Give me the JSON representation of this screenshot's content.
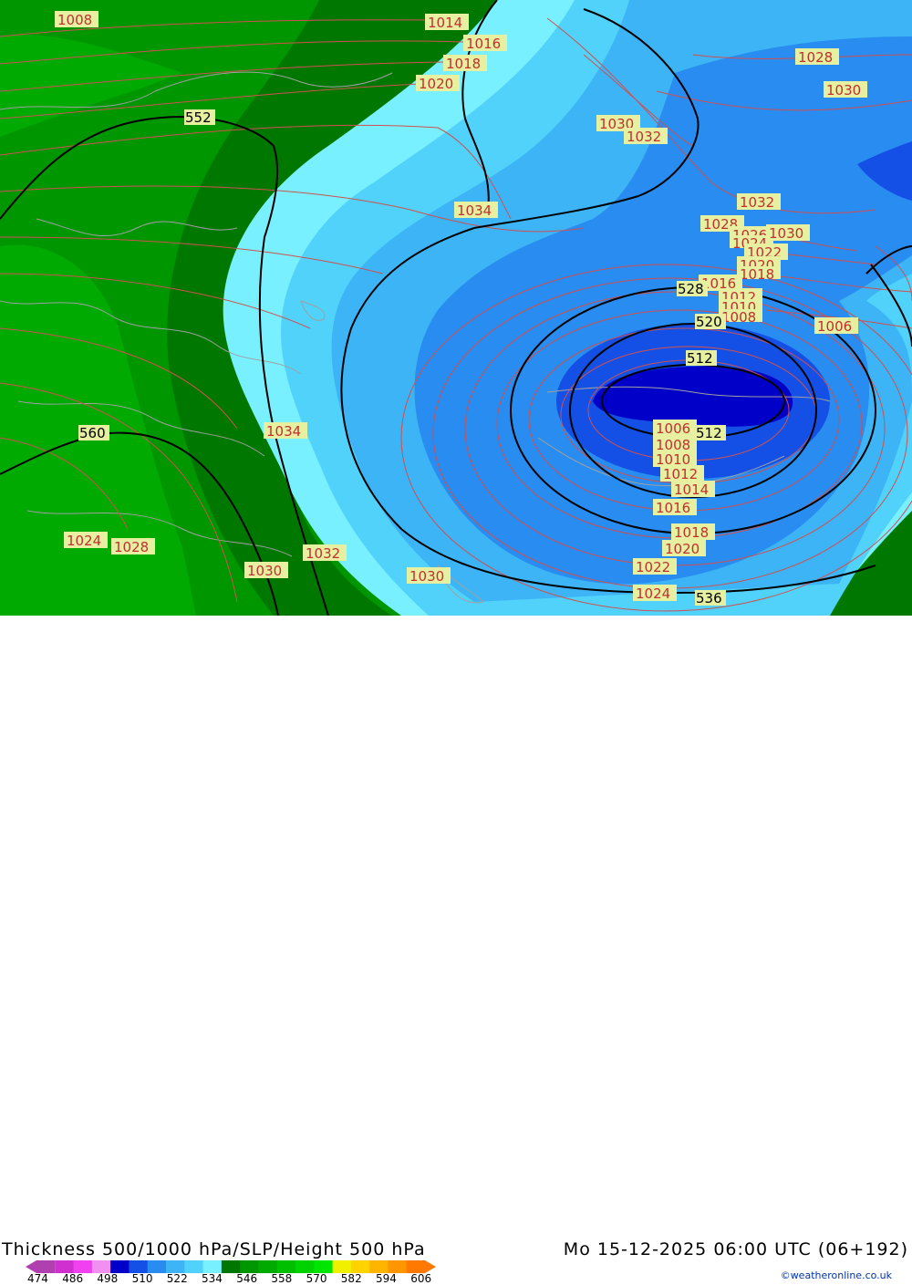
{
  "map": {
    "title": "Thickness 500/1000 hPa/SLP/Height 500 hPa",
    "datetime": "Mo 15-12-2025 06:00 UTC (06+192)",
    "credit": "©weatheronline.co.uk",
    "legend": {
      "ticks": [
        "474",
        "486",
        "498",
        "510",
        "522",
        "534",
        "546",
        "558",
        "570",
        "582",
        "594",
        "606"
      ],
      "colors": [
        "#b040b0",
        "#d030d0",
        "#f040f0",
        "#f090f0",
        "#0000c8",
        "#1450e6",
        "#288cf0",
        "#3cb4f5",
        "#50d2fa",
        "#78f0ff",
        "#007800",
        "#009600",
        "#00aa00",
        "#00be00",
        "#00d200",
        "#00e600",
        "#f0f000",
        "#ffd200",
        "#ffb400",
        "#ff9600",
        "#ff7800"
      ]
    },
    "slp_labels": [
      "1014",
      "1016",
      "1018",
      "1020",
      "1030",
      "1032",
      "1034",
      "1028",
      "1030",
      "1032",
      "1028",
      "1026",
      "1024",
      "1030",
      "1022",
      "1020",
      "1018",
      "1016",
      "1012",
      "1010",
      "1008",
      "1006",
      "1006",
      "1008",
      "1010",
      "1012",
      "1014",
      "1016",
      "1018",
      "1020",
      "1022",
      "1024",
      "1034",
      "1024",
      "1028",
      "1030",
      "1032",
      "1030",
      "1008"
    ],
    "height_labels": [
      "552",
      "560",
      "528",
      "520",
      "512",
      "512",
      "536"
    ],
    "colors": {
      "green_dark": "#007800",
      "green_mid": "#009600",
      "green_light": "#00aa00",
      "cyan_light": "#78f0ff",
      "cyan": "#50d2fa",
      "blue_light": "#3cb4f5",
      "blue_mid": "#288cf0",
      "blue": "#1450e6",
      "blue_deep": "#0000c8"
    }
  }
}
